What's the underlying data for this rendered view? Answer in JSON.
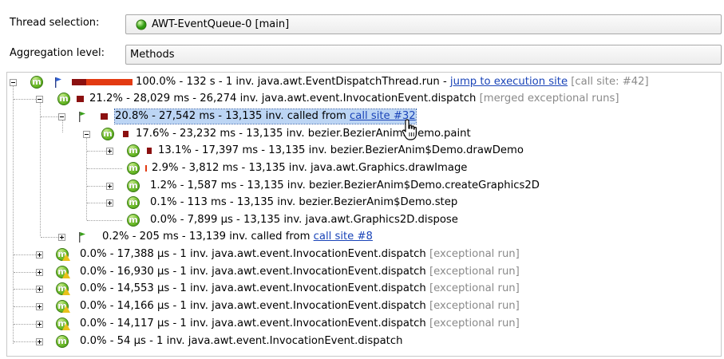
{
  "thread_selection": {
    "label": "Thread selection:",
    "value": "AWT-EventQueue-0 [main]"
  },
  "aggregation": {
    "label": "Aggregation level:",
    "value": "Methods"
  },
  "rows": [
    {
      "pct": "100.0%",
      "text": " - 132 s - 1 inv. java.awt.EventDispatchThread.run - ",
      "link": "jump to execution site",
      "extra": " [call site: #42]"
    },
    {
      "pct": "21.2%",
      "text": " - 28,029 ms - 26,274 inv. java.awt.event.InvocationEvent.dispatch",
      "extra": " [merged exceptional runs]"
    },
    {
      "pct": "20.8%",
      "text": " - 27,542 ms - 13,135 inv. called from ",
      "link": "call site #32"
    },
    {
      "pct": "17.6%",
      "text": " - 23,232 ms - 13,135 inv. bezier.BezierAnim$Demo.paint"
    },
    {
      "pct": "13.1%",
      "text": " - 17,397 ms - 13,135 inv. bezier.BezierAnim$Demo.drawDemo"
    },
    {
      "pct": "2.9%",
      "text": " - 3,812 ms - 13,135 inv. java.awt.Graphics.drawImage"
    },
    {
      "pct": "1.2%",
      "text": " - 1,587 ms - 13,135 inv. bezier.BezierAnim$Demo.createGraphics2D"
    },
    {
      "pct": "0.1%",
      "text": " - 113 ms - 13,135 inv. bezier.BezierAnim$Demo.step"
    },
    {
      "pct": "0.0%",
      "text": " - 7,899 µs - 13,135 inv. java.awt.Graphics2D.dispose"
    },
    {
      "pct": "0.2%",
      "text": " - 205 ms - 13,139 inv. called from ",
      "link": "call site #8"
    },
    {
      "pct": "0.0%",
      "text": " - 17,388 µs - 1 inv. java.awt.event.InvocationEvent.dispatch",
      "extra": " [exceptional run]"
    },
    {
      "pct": "0.0%",
      "text": " - 16,930 µs - 1 inv. java.awt.event.InvocationEvent.dispatch",
      "extra": " [exceptional run]"
    },
    {
      "pct": "0.0%",
      "text": " - 14,553 µs - 1 inv. java.awt.event.InvocationEvent.dispatch",
      "extra": " [exceptional run]"
    },
    {
      "pct": "0.0%",
      "text": " - 14,166 µs - 1 inv. java.awt.event.InvocationEvent.dispatch",
      "extra": " [exceptional run]"
    },
    {
      "pct": "0.0%",
      "text": " - 14,117 µs - 1 inv. java.awt.event.InvocationEvent.dispatch",
      "extra": " [exceptional run]"
    },
    {
      "pct": "0.0%",
      "text": " - 54 µs - 1 inv. java.awt.event.InvocationEvent.dispatch"
    }
  ],
  "icons": {
    "method": "m",
    "thread_status": "green-circle-icon",
    "call_site": "green-flag-icon",
    "exceptional": "warning-icon",
    "root": "blue-flag-icon"
  },
  "colors": {
    "bar_dark": "#8b1010",
    "bar_bright": "#e33a12",
    "link": "#1a44b8",
    "selection": "#bcd5f4",
    "method_icon": "#6fbf2a"
  }
}
